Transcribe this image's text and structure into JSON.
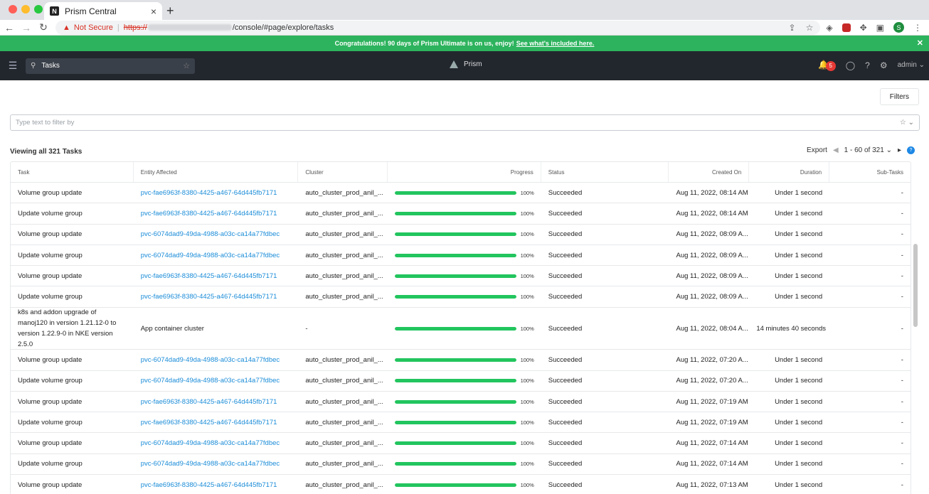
{
  "browser": {
    "tab_title": "Prism Central",
    "not_secure": "Not Secure",
    "url_scheme": "https://",
    "url_path": "/console/#page/explore/tasks",
    "avatar_letter": "S"
  },
  "banner": {
    "text": "Congratulations! 90 days of Prism Ultimate is on us, enjoy!",
    "link": "See what's included here."
  },
  "appbar": {
    "search_value": "Tasks",
    "brand": "Prism",
    "alert_count": "5",
    "user": "admin"
  },
  "toolbar": {
    "filters_label": "Filters",
    "filter_placeholder": "Type text to filter by",
    "viewing": "Viewing all 321 Tasks",
    "export_label": "Export",
    "pager": "1 - 60 of 321"
  },
  "table": {
    "headers": {
      "task": "Task",
      "entity": "Entity Affected",
      "cluster": "Cluster",
      "progress": "Progress",
      "status": "Status",
      "created": "Created On",
      "duration": "Duration",
      "subtasks": "Sub-Tasks"
    },
    "rows": [
      {
        "task": "Volume group update",
        "entity": "pvc-fae6963f-8380-4425-a467-64d445fb7171",
        "cluster": "auto_cluster_prod_anil_...",
        "progress": 100,
        "progress_label": "100%",
        "status": "Succeeded",
        "created": "Aug 11, 2022, 08:14 AM",
        "duration": "Under 1 second",
        "subtasks": "-"
      },
      {
        "task": "Update volume group",
        "entity": "pvc-fae6963f-8380-4425-a467-64d445fb7171",
        "cluster": "auto_cluster_prod_anil_...",
        "progress": 100,
        "progress_label": "100%",
        "status": "Succeeded",
        "created": "Aug 11, 2022, 08:14 AM",
        "duration": "Under 1 second",
        "subtasks": "-"
      },
      {
        "task": "Volume group update",
        "entity": "pvc-6074dad9-49da-4988-a03c-ca14a77fdbec",
        "cluster": "auto_cluster_prod_anil_...",
        "progress": 100,
        "progress_label": "100%",
        "status": "Succeeded",
        "created": "Aug 11, 2022, 08:09 A...",
        "duration": "Under 1 second",
        "subtasks": "-"
      },
      {
        "task": "Update volume group",
        "entity": "pvc-6074dad9-49da-4988-a03c-ca14a77fdbec",
        "cluster": "auto_cluster_prod_anil_...",
        "progress": 100,
        "progress_label": "100%",
        "status": "Succeeded",
        "created": "Aug 11, 2022, 08:09 A...",
        "duration": "Under 1 second",
        "subtasks": "-"
      },
      {
        "task": "Volume group update",
        "entity": "pvc-fae6963f-8380-4425-a467-64d445fb7171",
        "cluster": "auto_cluster_prod_anil_...",
        "progress": 100,
        "progress_label": "100%",
        "status": "Succeeded",
        "created": "Aug 11, 2022, 08:09 A...",
        "duration": "Under 1 second",
        "subtasks": "-"
      },
      {
        "task": "Update volume group",
        "entity": "pvc-fae6963f-8380-4425-a467-64d445fb7171",
        "cluster": "auto_cluster_prod_anil_...",
        "progress": 100,
        "progress_label": "100%",
        "status": "Succeeded",
        "created": "Aug 11, 2022, 08:09 A...",
        "duration": "Under 1 second",
        "subtasks": "-"
      },
      {
        "task": "k8s and addon upgrade of manoj120 in version 1.21.12-0 to version 1.22.9-0 in NKE version 2.5.0",
        "entity": "App container cluster",
        "cluster": "-",
        "progress": 100,
        "progress_label": "100%",
        "status": "Succeeded",
        "created": "Aug 11, 2022, 08:04 A...",
        "duration": "14 minutes 40 seconds",
        "subtasks": "-",
        "tall": true,
        "plain_entity": true
      },
      {
        "task": "Volume group update",
        "entity": "pvc-6074dad9-49da-4988-a03c-ca14a77fdbec",
        "cluster": "auto_cluster_prod_anil_...",
        "progress": 100,
        "progress_label": "100%",
        "status": "Succeeded",
        "created": "Aug 11, 2022, 07:20 A...",
        "duration": "Under 1 second",
        "subtasks": "-"
      },
      {
        "task": "Update volume group",
        "entity": "pvc-6074dad9-49da-4988-a03c-ca14a77fdbec",
        "cluster": "auto_cluster_prod_anil_...",
        "progress": 100,
        "progress_label": "100%",
        "status": "Succeeded",
        "created": "Aug 11, 2022, 07:20 A...",
        "duration": "Under 1 second",
        "subtasks": "-"
      },
      {
        "task": "Volume group update",
        "entity": "pvc-fae6963f-8380-4425-a467-64d445fb7171",
        "cluster": "auto_cluster_prod_anil_...",
        "progress": 100,
        "progress_label": "100%",
        "status": "Succeeded",
        "created": "Aug 11, 2022, 07:19 AM",
        "duration": "Under 1 second",
        "subtasks": "-"
      },
      {
        "task": "Update volume group",
        "entity": "pvc-fae6963f-8380-4425-a467-64d445fb7171",
        "cluster": "auto_cluster_prod_anil_...",
        "progress": 100,
        "progress_label": "100%",
        "status": "Succeeded",
        "created": "Aug 11, 2022, 07:19 AM",
        "duration": "Under 1 second",
        "subtasks": "-"
      },
      {
        "task": "Volume group update",
        "entity": "pvc-6074dad9-49da-4988-a03c-ca14a77fdbec",
        "cluster": "auto_cluster_prod_anil_...",
        "progress": 100,
        "progress_label": "100%",
        "status": "Succeeded",
        "created": "Aug 11, 2022, 07:14 AM",
        "duration": "Under 1 second",
        "subtasks": "-"
      },
      {
        "task": "Update volume group",
        "entity": "pvc-6074dad9-49da-4988-a03c-ca14a77fdbec",
        "cluster": "auto_cluster_prod_anil_...",
        "progress": 100,
        "progress_label": "100%",
        "status": "Succeeded",
        "created": "Aug 11, 2022, 07:14 AM",
        "duration": "Under 1 second",
        "subtasks": "-"
      },
      {
        "task": "Volume group update",
        "entity": "pvc-fae6963f-8380-4425-a467-64d445fb7171",
        "cluster": "auto_cluster_prod_anil_...",
        "progress": 100,
        "progress_label": "100%",
        "status": "Succeeded",
        "created": "Aug 11, 2022, 07:13 AM",
        "duration": "Under 1 second",
        "subtasks": "-"
      }
    ]
  },
  "colors": {
    "banner": "#2db35d",
    "appbar": "#22272e",
    "link": "#1a8cd8",
    "progress": "#22c55e",
    "alert": "#e53935"
  }
}
